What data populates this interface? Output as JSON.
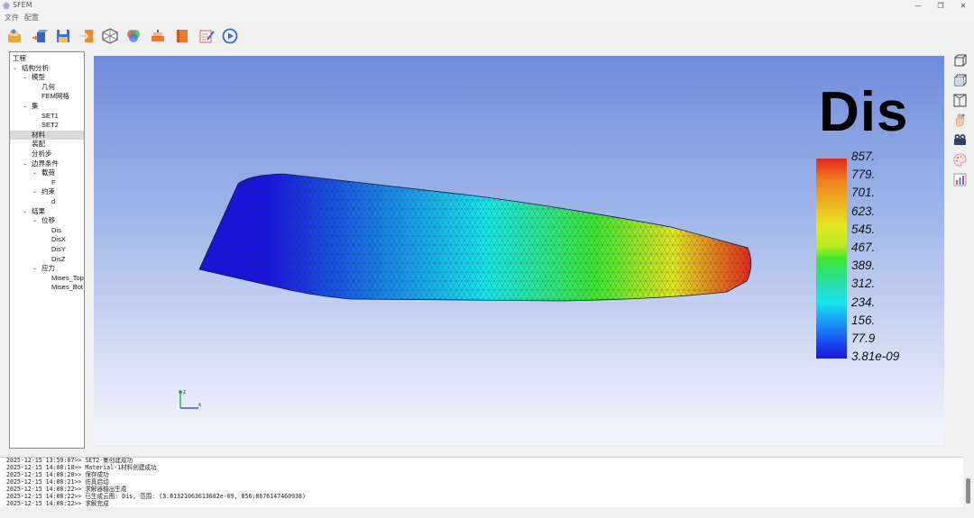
{
  "window": {
    "title": "SFEM",
    "min": "—",
    "restore": "❐",
    "close": "✕"
  },
  "menu": [
    "文件",
    "配置"
  ],
  "toolbar": [
    {
      "icon": "folder-open-icon"
    },
    {
      "icon": "import-cube-icon"
    },
    {
      "icon": "save-icon"
    },
    {
      "icon": "export-icon"
    },
    {
      "icon": "mesh-grid-icon"
    },
    {
      "icon": "sets-venn-icon"
    },
    {
      "icon": "material-icon"
    },
    {
      "icon": "book-icon"
    },
    {
      "icon": "edit-icon"
    },
    {
      "icon": "run-play-icon"
    }
  ],
  "tree": [
    {
      "label": "工程",
      "level": 0,
      "caret": false
    },
    {
      "label": "结构分析",
      "level": 0,
      "caret": true
    },
    {
      "label": "模型",
      "level": 1,
      "caret": true
    },
    {
      "label": "几何",
      "level": 2,
      "caret": false
    },
    {
      "label": "FEM网格",
      "level": 2,
      "caret": false
    },
    {
      "label": "集",
      "level": 1,
      "caret": true
    },
    {
      "label": "SET1",
      "level": 2,
      "caret": false
    },
    {
      "label": "SET2",
      "level": 2,
      "caret": false
    },
    {
      "label": "材料",
      "level": 1,
      "caret": false,
      "selected": true
    },
    {
      "label": "装配",
      "level": 1,
      "caret": false
    },
    {
      "label": "分析步",
      "level": 1,
      "caret": false
    },
    {
      "label": "边界条件",
      "level": 1,
      "caret": true
    },
    {
      "label": "载荷",
      "level": 2,
      "caret": true
    },
    {
      "label": "F",
      "level": 3,
      "caret": false
    },
    {
      "label": "约束",
      "level": 2,
      "caret": true
    },
    {
      "label": "d",
      "level": 3,
      "caret": false
    },
    {
      "label": "结果",
      "level": 1,
      "caret": true
    },
    {
      "label": "位移",
      "level": 2,
      "caret": true
    },
    {
      "label": "Dis",
      "level": 3,
      "caret": false
    },
    {
      "label": "DisX",
      "level": 3,
      "caret": false
    },
    {
      "label": "DisY",
      "level": 3,
      "caret": false
    },
    {
      "label": "DisZ",
      "level": 3,
      "caret": false
    },
    {
      "label": "应力",
      "level": 2,
      "caret": true
    },
    {
      "label": "Mises_Top",
      "level": 3,
      "caret": false
    },
    {
      "label": "Mises_Bot",
      "level": 3,
      "caret": false
    }
  ],
  "viewport": {
    "legend_title": "Dis",
    "legend_labels": [
      "857.",
      "779.",
      "701.",
      "623.",
      "545.",
      "467.",
      "389.",
      "312.",
      "234.",
      "156.",
      "77.9",
      "3.81e-09"
    ],
    "axis_z": "z",
    "axis_x": "x",
    "colormap": [
      "#1a12e0",
      "#18e6ee",
      "#3fe82f",
      "#e6e620",
      "#e5261a"
    ]
  },
  "right_tools": [
    {
      "icon": "view-front-cube-icon"
    },
    {
      "icon": "view-iso-cube-icon"
    },
    {
      "icon": "wireframe-cube-icon"
    },
    {
      "icon": "hand-pan-icon"
    },
    {
      "icon": "camera-icon"
    },
    {
      "icon": "palette-icon"
    },
    {
      "icon": "chart-icon"
    }
  ],
  "log": [
    "2025-12-15 13:59:07>> SET2-集创建成功",
    "2025-12-15 14:00:18>> Material-1材料创建成功",
    "2025-12-15 14:00:20>> 保存成功",
    "2025-12-15 14:00:21>> 仿真启动",
    "2025-12-15 14:00:22>> 求解器输出生成",
    "2025-12-15 14:00:22>> 已生成云图: Dis, 范围: (3.81321063613682e-09, 856.8676147460938)",
    "2025-12-15 14:00:22>> 求解完成"
  ]
}
